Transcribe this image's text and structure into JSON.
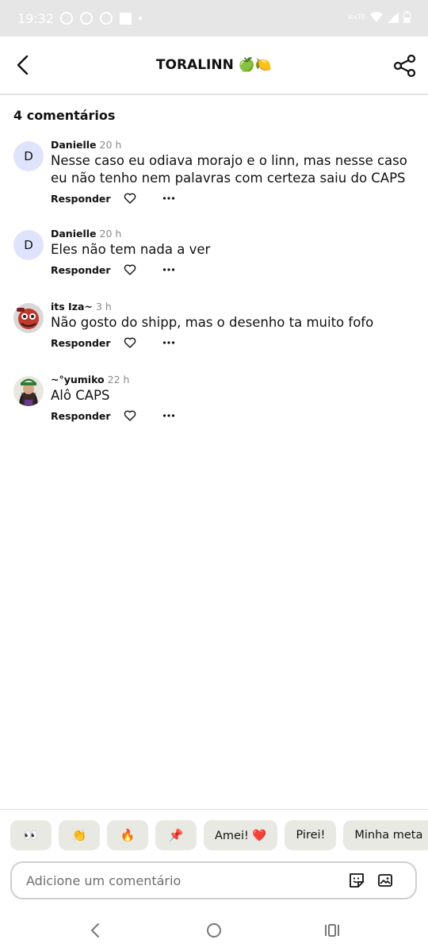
{
  "status_bar": {
    "time": "19:32",
    "network": "VoLTE"
  },
  "header": {
    "title": "TORALINN 🍏🍋"
  },
  "comments_count": "4 comentários",
  "comments": [
    {
      "avatar_letter": "D",
      "author": "Danielle",
      "time": "20 h",
      "text": "Nesse caso eu odiava morajo e o linn, mas nesse caso eu não tenho nem palavras com certeza saiu do CAPS",
      "reply": "Responder"
    },
    {
      "avatar_letter": "D",
      "author": "Danielle",
      "time": "20 h",
      "text": "Eles não tem nada a ver",
      "reply": "Responder"
    },
    {
      "avatar_letter": "",
      "author": "its Iza~",
      "time": "3 h",
      "text": "Não gosto do shipp, mas o desenho ta muito fofo",
      "reply": "Responder"
    },
    {
      "avatar_letter": "",
      "author": "~°yumiko",
      "time": "22 h",
      "text": "Alô CAPS",
      "reply": "Responder"
    }
  ],
  "quick_reactions": [
    "👀",
    "👏",
    "🔥",
    "📌",
    "Amei! ❤️",
    "Pirei!",
    "Minha meta"
  ],
  "input": {
    "placeholder": "Adicione um comentário"
  },
  "colors": {
    "avatar_bg": "#dfe3fb",
    "status_bar_bg": "#e6e6e6",
    "chip_bg": "#e9e9e4"
  }
}
